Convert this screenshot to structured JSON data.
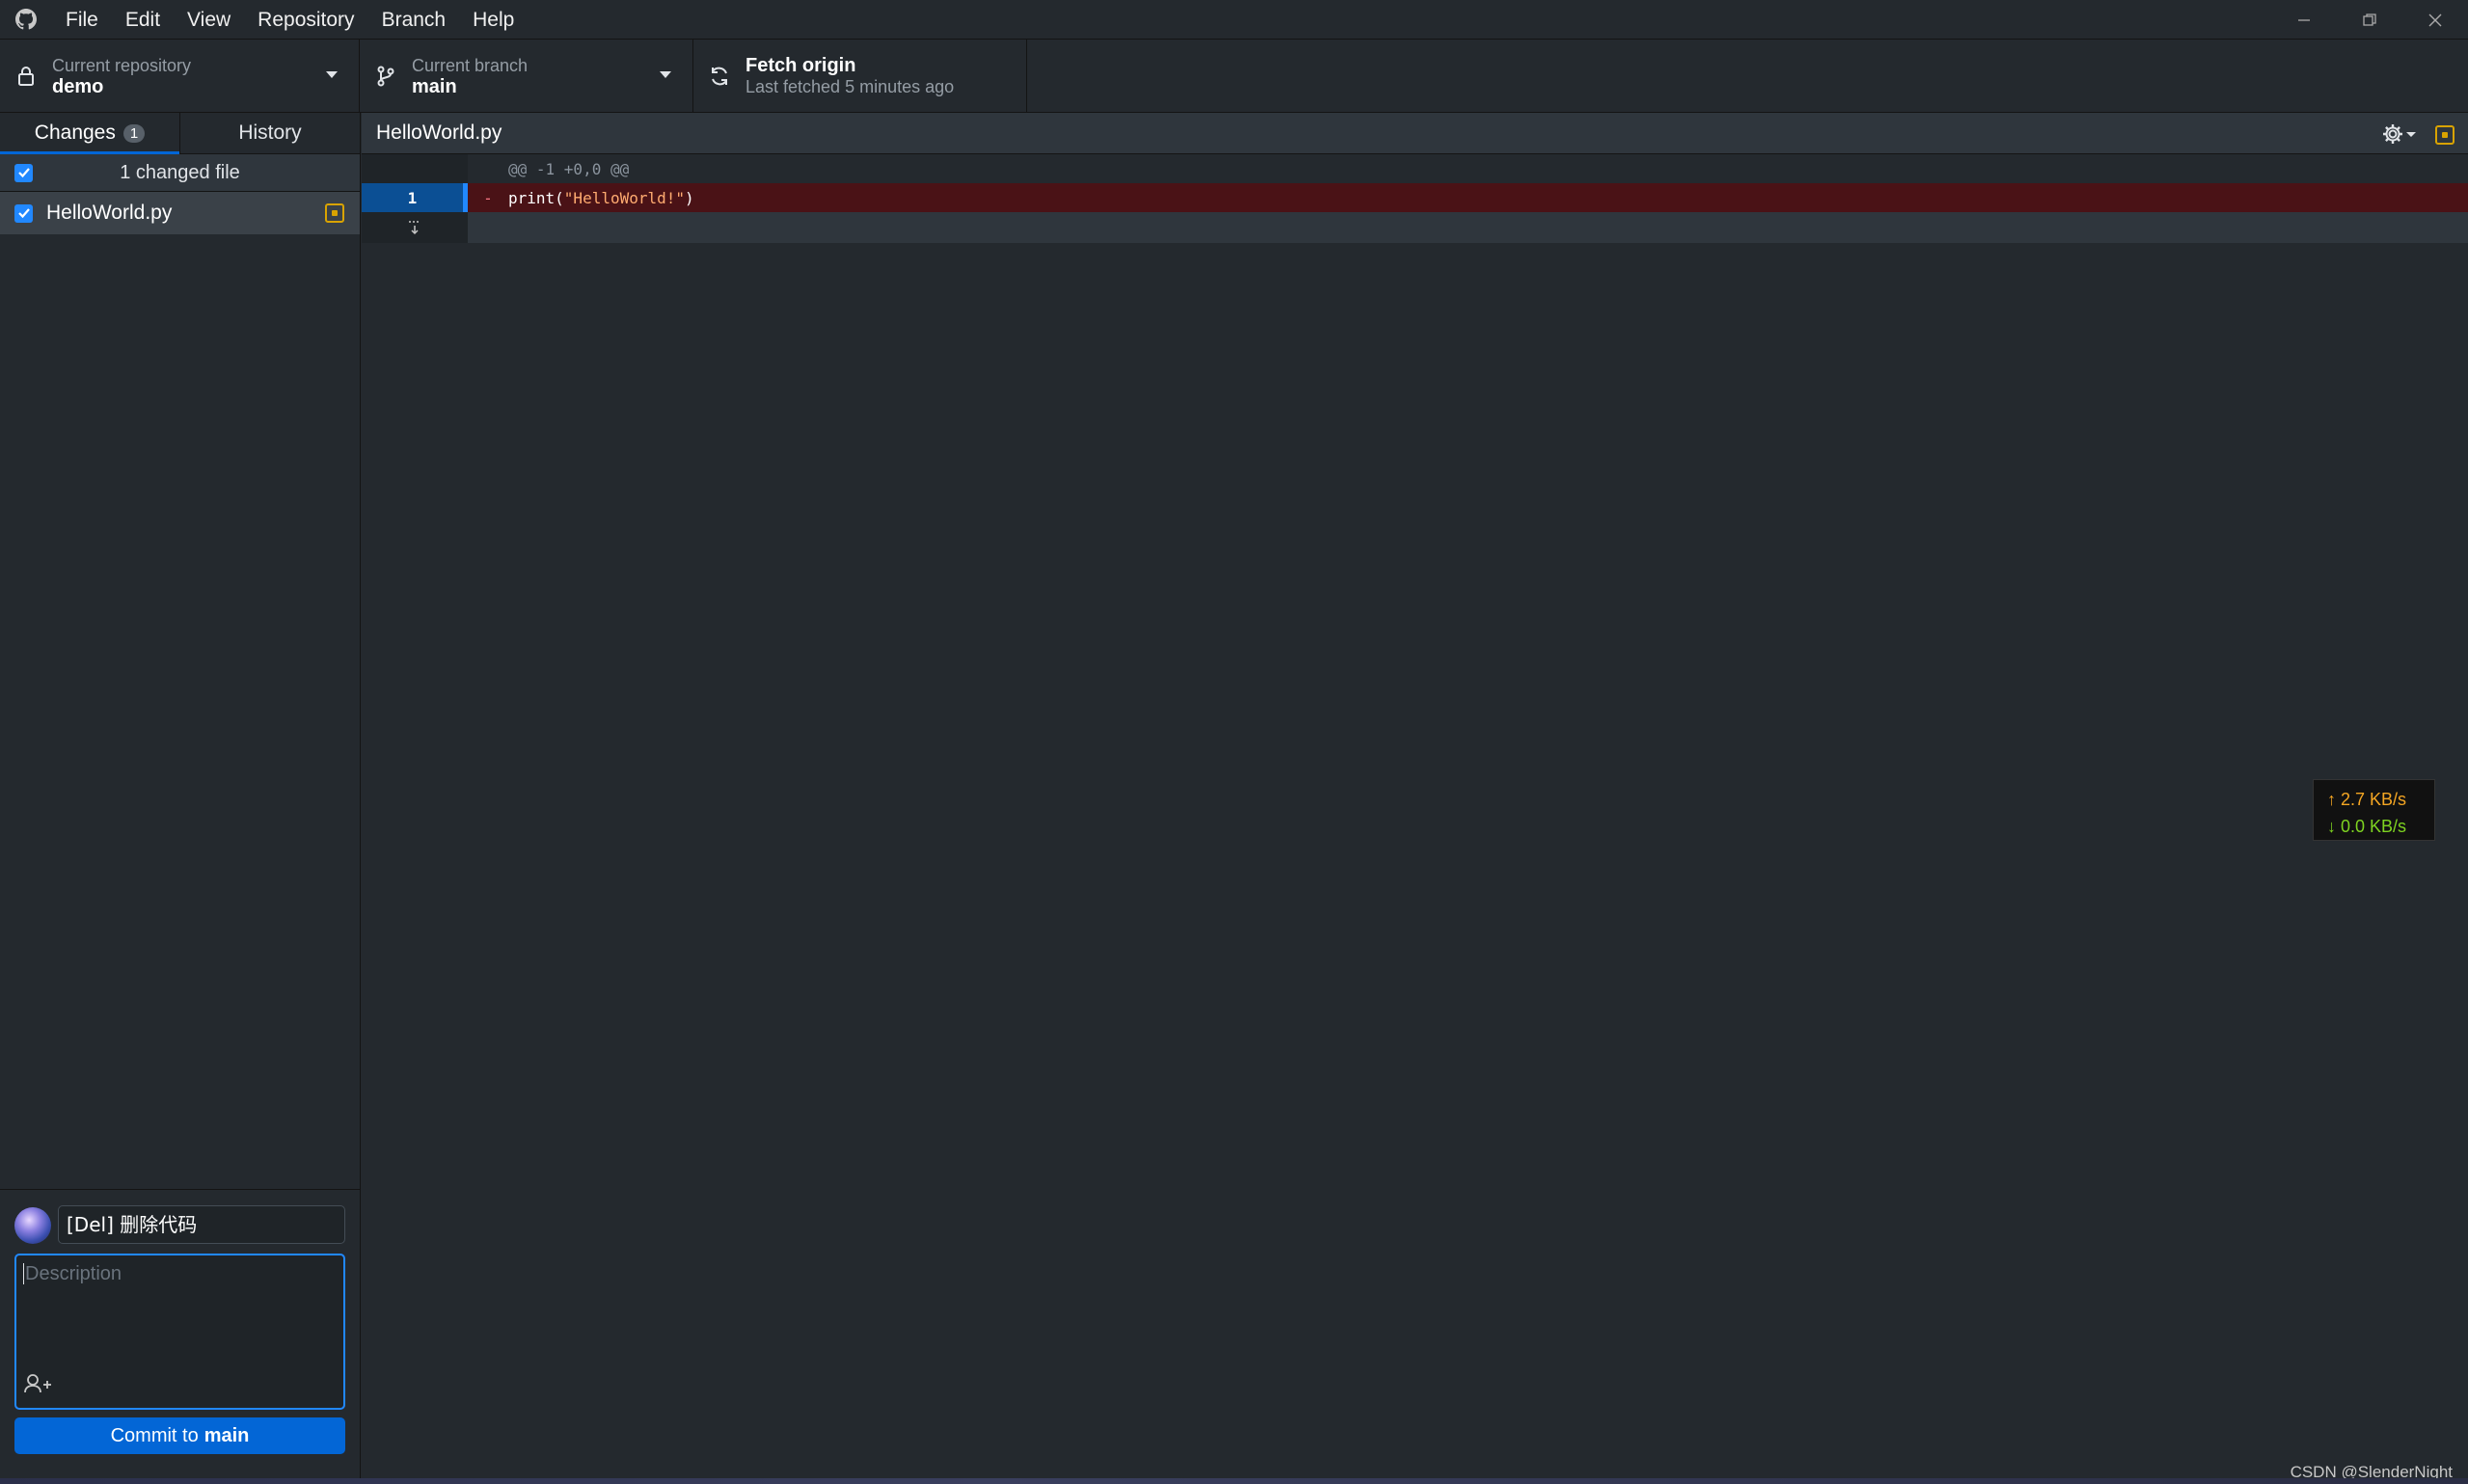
{
  "menu": [
    "File",
    "Edit",
    "View",
    "Repository",
    "Branch",
    "Help"
  ],
  "toolbar": {
    "repo_label": "Current repository",
    "repo_value": "demo",
    "branch_label": "Current branch",
    "branch_value": "main",
    "fetch_label": "Fetch origin",
    "fetch_sub": "Last fetched 5 minutes ago"
  },
  "tabs": {
    "changes": "Changes",
    "changes_count": "1",
    "history": "History"
  },
  "changes": {
    "header": "1 changed file",
    "files": [
      {
        "name": "HelloWorld.py",
        "status": "modified"
      }
    ]
  },
  "commit": {
    "summary": "[Del] 删除代码",
    "description_placeholder": "Description",
    "button_prefix": "Commit to",
    "button_branch": "main"
  },
  "diff": {
    "filename": "HelloWorld.py",
    "hunk_header": "@@ -1 +0,0 @@",
    "lines": [
      {
        "number": "1",
        "sign": "-",
        "code_prefix": "print(",
        "code_string": "\"HelloWorld!\"",
        "code_suffix": ")"
      }
    ]
  },
  "network": {
    "up": "↑ 2.7 KB/s",
    "down": "↓ 0.0 KB/s"
  },
  "watermark": "CSDN @SlenderNight",
  "colors": {
    "accent": "#0366d6",
    "modified": "#d9a300",
    "deleted_bg": "#4a1216"
  }
}
